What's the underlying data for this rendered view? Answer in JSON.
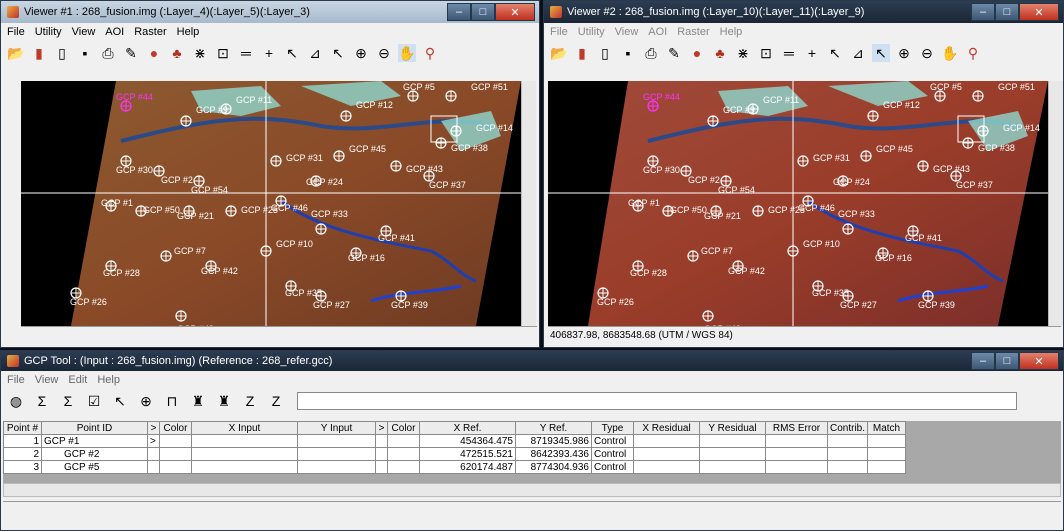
{
  "viewer1": {
    "title": "Viewer #1 : 268_fusion.img (:Layer_4)(:Layer_5)(:Layer_3)",
    "menu": [
      "File",
      "Utility",
      "View",
      "AOI",
      "Raster",
      "Help"
    ],
    "status": ""
  },
  "viewer2": {
    "title": "Viewer #2 : 268_fusion.img (:Layer_10)(:Layer_11)(:Layer_9)",
    "menu": [
      "File",
      "Utility",
      "View",
      "AOI",
      "Raster",
      "Help"
    ],
    "status": "406837.98, 8683548.68  (UTM / WGS 84)"
  },
  "gcp_points": [
    {
      "label": "GCP #44",
      "color": "#ff33ff"
    },
    {
      "label": "GCP #9",
      "color": "#ffffff"
    },
    {
      "label": "GCP #11",
      "color": "#ffffff"
    },
    {
      "label": "GCP #12",
      "color": "#ffffff"
    },
    {
      "label": "GCP #5",
      "color": "#ffffff"
    },
    {
      "label": "GCP #51",
      "color": "#ffffff"
    },
    {
      "label": "GCP #14",
      "color": "#ffffff"
    },
    {
      "label": "GCP #38",
      "color": "#ffffff"
    },
    {
      "label": "GCP #30",
      "color": "#ffffff"
    },
    {
      "label": "GCP #2",
      "color": "#ffffff"
    },
    {
      "label": "GCP #31",
      "color": "#ffffff"
    },
    {
      "label": "GCP #45",
      "color": "#ffffff"
    },
    {
      "label": "GCP #43",
      "color": "#ffffff"
    },
    {
      "label": "GCP #37",
      "color": "#ffffff"
    },
    {
      "label": "GCP #54",
      "color": "#ffffff"
    },
    {
      "label": "GCP #24",
      "color": "#ffffff"
    },
    {
      "label": "GCP #1",
      "color": "#ffffff"
    },
    {
      "label": "GCP #50",
      "color": "#ffffff"
    },
    {
      "label": "GCP #21",
      "color": "#ffffff"
    },
    {
      "label": "GCP #25",
      "color": "#ffffff"
    },
    {
      "label": "GCP #46",
      "color": "#ffffff"
    },
    {
      "label": "GCP #33",
      "color": "#ffffff"
    },
    {
      "label": "GCP #41",
      "color": "#ffffff"
    },
    {
      "label": "GCP #7",
      "color": "#ffffff"
    },
    {
      "label": "GCP #10",
      "color": "#ffffff"
    },
    {
      "label": "GCP #16",
      "color": "#ffffff"
    },
    {
      "label": "GCP #28",
      "color": "#ffffff"
    },
    {
      "label": "GCP #42",
      "color": "#ffffff"
    },
    {
      "label": "GCP #35",
      "color": "#ffffff"
    },
    {
      "label": "GCP #26",
      "color": "#ffffff"
    },
    {
      "label": "GCP #27",
      "color": "#ffffff"
    },
    {
      "label": "GCP #39",
      "color": "#ffffff"
    },
    {
      "label": "GCP #49",
      "color": "#ffffff"
    }
  ],
  "gcptool": {
    "title": "GCP Tool : (Input : 268_fusion.img) (Reference : 268_refer.gcc)",
    "menu": [
      "File",
      "View",
      "Edit",
      "Help"
    ],
    "columns": [
      "Point #",
      "Point ID",
      ">",
      "Color",
      "X Input",
      "Y Input",
      ">",
      "Color",
      "X Ref.",
      "Y Ref.",
      "Type",
      "X Residual",
      "Y Residual",
      "RMS Error",
      "Contrib.",
      "Match"
    ],
    "rows": [
      {
        "num": "1",
        "id": "GCP #1",
        "arrow": ">",
        "xref": "454364.475",
        "yref": "8719345.986",
        "type": "Control"
      },
      {
        "num": "2",
        "id": "GCP #2",
        "arrow": "",
        "xref": "472515.521",
        "yref": "8642393.436",
        "type": "Control"
      },
      {
        "num": "3",
        "id": "GCP #5",
        "arrow": "",
        "xref": "620174.487",
        "yref": "8774304.936",
        "type": "Control"
      }
    ]
  }
}
